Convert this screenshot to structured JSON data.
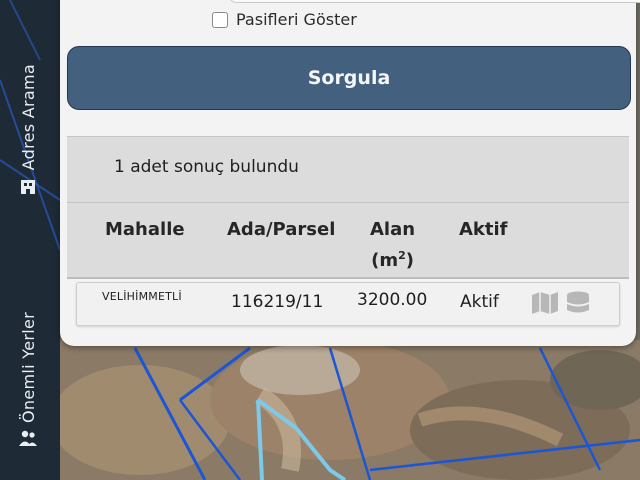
{
  "sidebar": {
    "tabs": [
      {
        "label": "Adres Arama",
        "icon": "building-icon"
      },
      {
        "label": "Önemli Yerler",
        "icon": "people-icon"
      }
    ]
  },
  "search": {
    "show_passive_label": "Pasifleri Göster",
    "show_passive_checked": false,
    "submit_label": "Sorgula"
  },
  "results": {
    "count_text": "1 adet sonuç bulundu",
    "headers": {
      "mahalle": "Mahalle",
      "ada_parsel": "Ada/Parsel",
      "alan_line1": "Alan",
      "alan_unit": "(m",
      "alan_sup": "2",
      "alan_close": ")",
      "aktif": "Aktif"
    },
    "rows": [
      {
        "mahalle": "VELİHİMMETLİ",
        "ada_parsel": "116219/11",
        "alan": "3200.00",
        "aktif": "Aktif"
      }
    ]
  },
  "colors": {
    "submit_bg": "#43617f",
    "sidebar_bg": "#1e2a36",
    "parcel_line": "#1a56d6",
    "highlight_line": "#7ec8ea"
  }
}
